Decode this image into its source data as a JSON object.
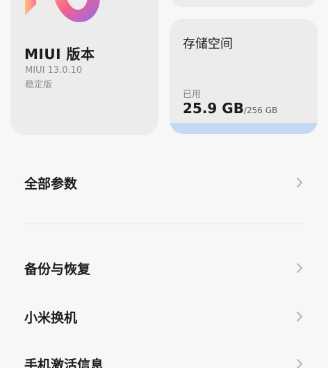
{
  "miui_card": {
    "title": "MIUI 版本",
    "version": "MIUI 13.0.10",
    "channel": "稳定版"
  },
  "storage_card": {
    "title": "存储空间",
    "used_label": "已用",
    "used_value": "25.9 GB",
    "total_value": "/256 GB",
    "used_fraction": 0.1
  },
  "list": {
    "all_specs": "全部参数",
    "backup_restore": "备份与恢复",
    "mi_mover": "小米换机",
    "activation_info": "手机激活信息"
  },
  "icons": {
    "chevron": "chevron-right-icon",
    "logo": "miui-logo-icon"
  },
  "colors": {
    "background": "#f7f7f7",
    "card": "#ececec",
    "storage_bar": "#c6d9f2"
  }
}
